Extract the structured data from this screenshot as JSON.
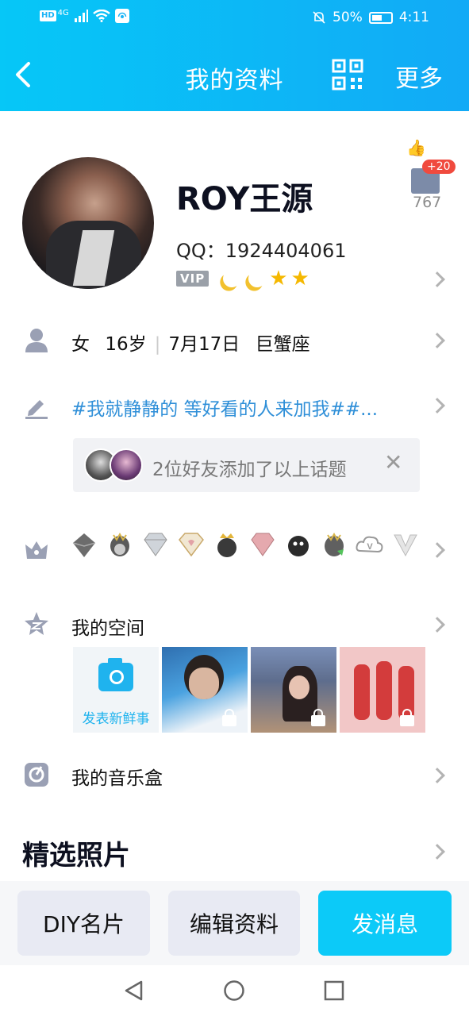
{
  "status_bar": {
    "hd": "HD",
    "network": "4G",
    "battery": "50%",
    "time": "4:11",
    "icons": [
      "signal-icon",
      "wifi-icon",
      "hotspot-icon",
      "mute-icon",
      "battery-icon"
    ]
  },
  "header": {
    "title": "我的资料",
    "more_label": "更多",
    "icons": [
      "back-icon",
      "qr-code-icon"
    ]
  },
  "profile": {
    "name": "ROY王源",
    "qq_label": "QQ：",
    "qq_number": "1924404061",
    "vip_badge": "VIP",
    "level_icons": [
      "moon",
      "moon",
      "star",
      "star"
    ],
    "likes": {
      "new_likes": "+20",
      "count": "767"
    }
  },
  "info_row": {
    "gender": "女",
    "age": "16岁",
    "birthday": "7月17日",
    "zodiac": "巨蟹座"
  },
  "signature": {
    "text": "#我就静静的 等好看的人来加我##..."
  },
  "topic_notice": {
    "text": "2位好友添加了以上话题",
    "close": "✕"
  },
  "medals": {
    "icons": [
      "crown-gem-medal",
      "qq-penguin-medal",
      "diamond-medal",
      "gold-diamond-medal",
      "crown-penguin-medal",
      "pink-diamond-medal",
      "black-penguin-medal",
      "green-penguin-medal",
      "svip-cloud-medal",
      "v-medal"
    ]
  },
  "qzone": {
    "label": "我的空间",
    "post_label": "发表新鲜事"
  },
  "music": {
    "label": "我的音乐盒"
  },
  "featured_photos": {
    "title": "精选照片"
  },
  "bottom_buttons": {
    "diy": "DIY名片",
    "edit": "编辑资料",
    "message": "发消息"
  },
  "colors": {
    "header_start": "#06c7f7",
    "header_end": "#12aaf6",
    "accent": "#0ccaf8",
    "signature": "#2f8fd8",
    "like_badge": "#f04a3e"
  }
}
